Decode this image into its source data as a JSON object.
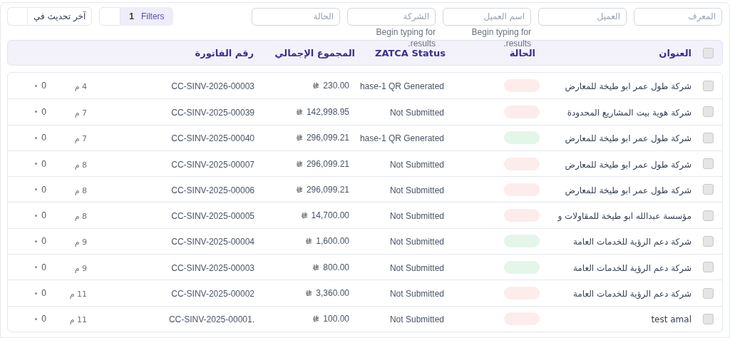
{
  "toolbar": {
    "sort": {
      "label": "آخر تحديث في"
    },
    "filters": {
      "label": "Filters",
      "count": "1"
    },
    "fields": [
      {
        "placeholder": "المعرف"
      },
      {
        "placeholder": "العميل"
      },
      {
        "placeholder": "اسم العميل",
        "hint": "Begin typing for results."
      },
      {
        "placeholder": "الشركة",
        "hint": "Begin typing for results."
      },
      {
        "placeholder": "الحالة"
      }
    ]
  },
  "table": {
    "select_all": {
      "checked": false
    },
    "columns": [
      "العنوان",
      "الحالة",
      "ZATCA Status",
      "المجموع الإجمالي",
      "رقم الفاتورة"
    ],
    "rows": [
      {
        "checked": false,
        "title": "شركة طول عمر ابو طيخة للمعارض",
        "color": "#fdecec",
        "zatca": "hase-1 QR Generated",
        "total": "230.00",
        "id": "CC-SINV-2026-00003",
        "age": "4 م",
        "comments": "0"
      },
      {
        "checked": false,
        "title": "شركة هوية بيت المشاريع المحدودة",
        "color": "#fdecec",
        "zatca": "Not Submitted",
        "total": "142,998.95",
        "id": "CC-SINV-2025-00039",
        "age": "7 م",
        "comments": "0"
      },
      {
        "checked": false,
        "title": "شركة طول عمر ابو طيخة للمعارض",
        "color": "#e4f5e9",
        "zatca": "hase-1 QR Generated",
        "total": "296,099.21",
        "id": "CC-SINV-2025-00040",
        "age": "7 م",
        "comments": "0"
      },
      {
        "checked": false,
        "title": "شركة طول عمر ابو طيخة للمعارض",
        "color": "#fdecec",
        "zatca": "Not Submitted",
        "total": "296,099.21",
        "id": "CC-SINV-2025-00007",
        "age": "8 م",
        "comments": "0"
      },
      {
        "checked": false,
        "title": "شركة طول عمر ابو طيخة للمعارض",
        "color": "#fdecec",
        "zatca": "Not Submitted",
        "total": "296,099.21",
        "id": "CC-SINV-2025-00006",
        "age": "8 م",
        "comments": "0"
      },
      {
        "checked": false,
        "title": "مؤسسة عبدالله ابو طيخة للمقاولات و",
        "color": "#fdecec",
        "zatca": "Not Submitted",
        "total": "14,700.00",
        "id": "CC-SINV-2025-00005",
        "age": "8 م",
        "comments": "0"
      },
      {
        "checked": false,
        "title": "شركة دعم الرؤية للخدمات العامة",
        "color": "#e4f5e9",
        "zatca": "Not Submitted",
        "total": "1,600.00",
        "id": "CC-SINV-2025-00004",
        "age": "9 م",
        "comments": "0"
      },
      {
        "checked": false,
        "title": "شركة دعم الرؤية للخدمات العامة",
        "color": "#e4f5e9",
        "zatca": "Not Submitted",
        "total": "800.00",
        "id": "CC-SINV-2025-00003",
        "age": "9 م",
        "comments": "0"
      },
      {
        "checked": false,
        "title": "شركة دعم الرؤية للخدمات العامة",
        "color": "#fdecec",
        "zatca": "Not Submitted",
        "total": "3,360.00",
        "id": "CC-SINV-2025-00002",
        "age": "11 م",
        "comments": "0"
      },
      {
        "checked": false,
        "title": "test amal",
        "color": "#fdecec",
        "zatca": "Not Submitted",
        "total": "100.00",
        "id": "CC-SINV-2025-00001.",
        "age": "11 م",
        "comments": "0"
      }
    ]
  }
}
